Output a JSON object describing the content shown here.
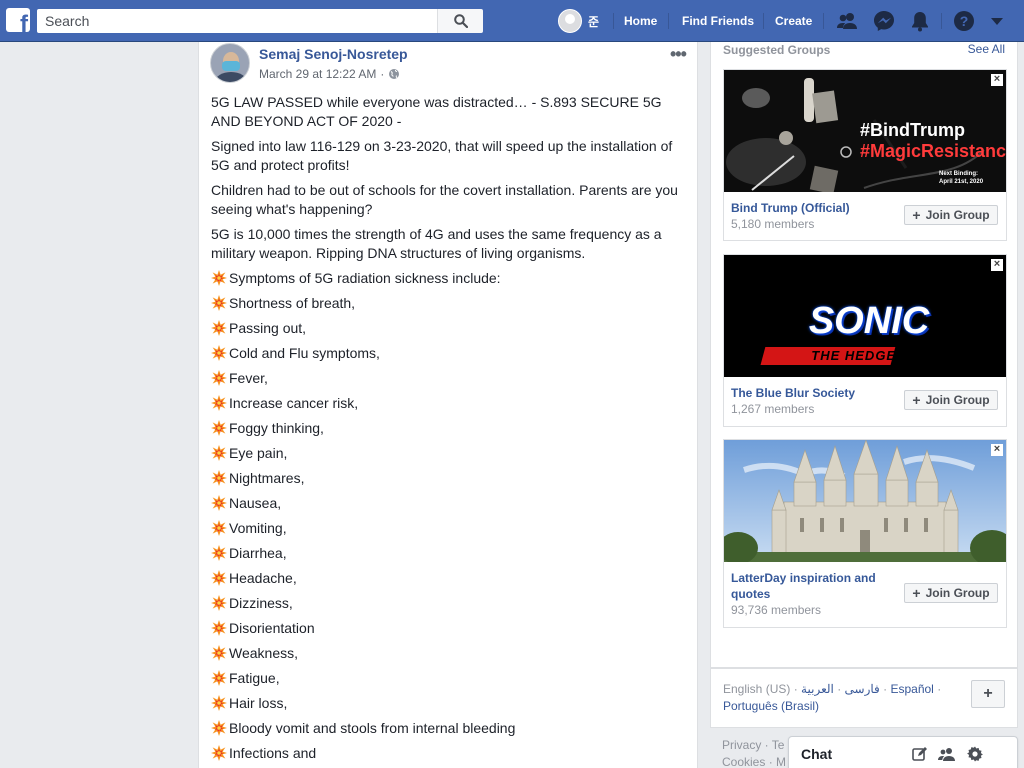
{
  "topbar": {
    "search_placeholder": "Search",
    "user_name": "준",
    "nav": {
      "home": "Home",
      "find_friends": "Find Friends",
      "create": "Create"
    },
    "icons": [
      "friends-icon",
      "messenger-icon",
      "notifications-icon",
      "help-icon",
      "menu-caret-icon"
    ]
  },
  "post": {
    "author": "Semaj Senoj-Nosretep",
    "timestamp": "March 29 at 12:22 AM",
    "audience_icon": "globe-icon",
    "paragraphs": [
      "5G LAW PASSED while everyone was distracted… - S.893 SECURE 5G AND BEYOND ACT OF 2020 -",
      "Signed into law 116-129 on 3-23-2020, that will speed up the installation of 5G and protect profits!",
      "Children had to be out of schools for the covert installation. Parents are you seeing what's happening?",
      "5G is 10,000 times the strength of 4G and uses the same frequency as a military weapon. Ripping DNA structures of living organisms."
    ],
    "list": [
      "Symptoms of 5G radiation sickness include:",
      "Shortness of breath,",
      "Passing out,",
      "Cold and Flu symptoms,",
      "Fever,",
      "Increase cancer risk,",
      "Foggy thinking,",
      "Eye pain,",
      "Nightmares,",
      "Nausea,",
      "Vomiting,",
      "Diarrhea,",
      "Headache,",
      "Dizziness,",
      "Disorientation",
      "Weakness,",
      "Fatigue,",
      "Hair loss,",
      "Bloody vomit and stools from internal bleeding",
      "Infections and"
    ]
  },
  "suggested": {
    "title": "Suggested Groups",
    "see_all": "See All",
    "join_label": "Join Group",
    "groups": [
      {
        "name": "Bind Trump (Official)",
        "members": "5,180 members",
        "image_text_1": "#BindTrump",
        "image_text_2": "#MagicResistance",
        "image_text_3": "Next Binding:",
        "image_text_4": "April 21st, 2020"
      },
      {
        "name": "The Blue Blur Society",
        "members": "1,267 members",
        "image_text_1": "SONIC",
        "image_text_2": "THE HEDGEHOG"
      },
      {
        "name": "LatterDay inspiration and quotes",
        "members": "93,736 members"
      }
    ]
  },
  "languages": {
    "current": "English (US)",
    "others": [
      "فارسی",
      "العربية",
      "Español",
      "Português (Brasil)"
    ],
    "sep": "·",
    "add": "+"
  },
  "footer": {
    "line1": "Privacy · Te",
    "line2": "Cookies · M"
  },
  "chat": {
    "label": "Chat"
  }
}
